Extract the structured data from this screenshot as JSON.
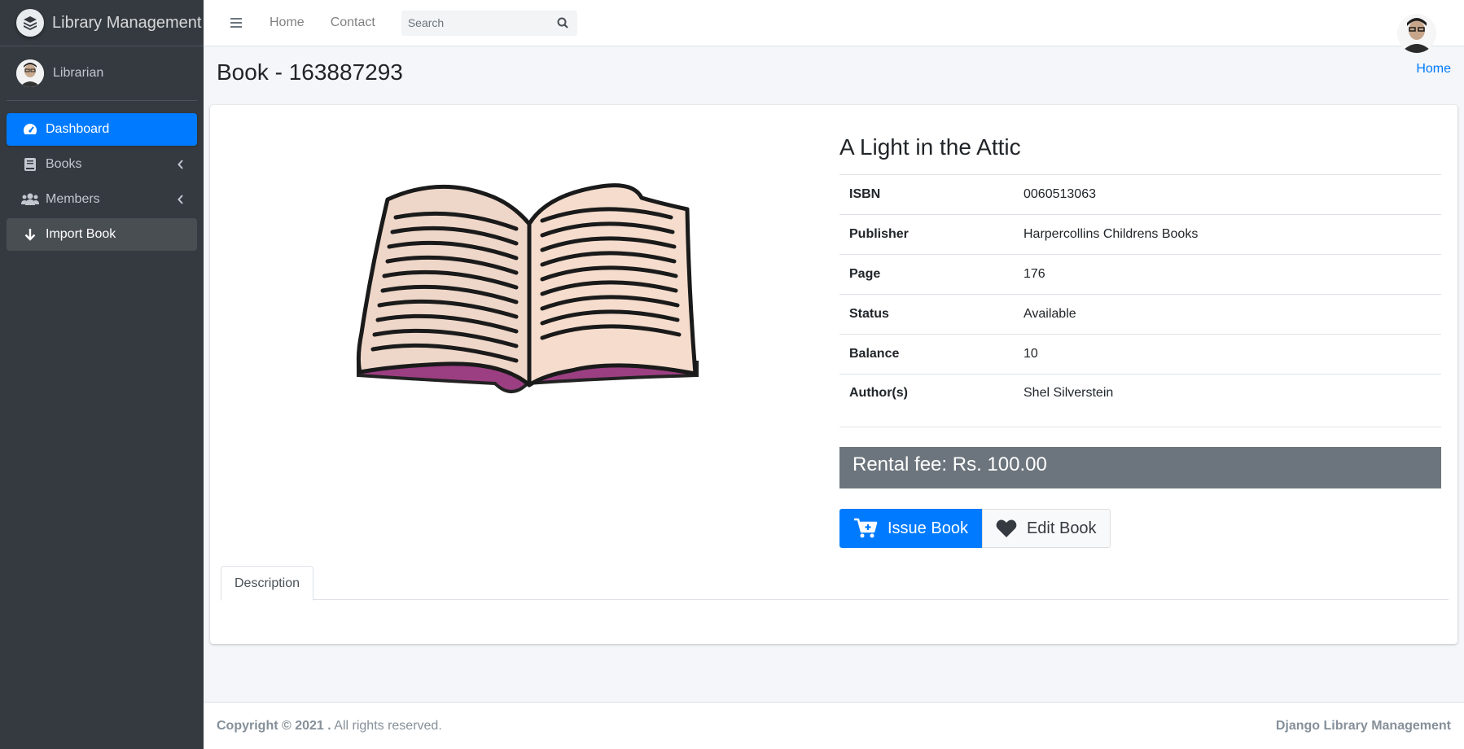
{
  "brand": {
    "name": "Library Management",
    "icon": "layers-logo-icon"
  },
  "user": {
    "name": "Librarian"
  },
  "sidebar": {
    "items": [
      {
        "label": "Dashboard",
        "icon": "tachometer-icon",
        "active": true
      },
      {
        "label": "Books",
        "icon": "book-icon",
        "has_children": true
      },
      {
        "label": "Members",
        "icon": "users-icon",
        "has_children": true
      },
      {
        "label": "Import Book",
        "icon": "arrow-down-icon"
      }
    ]
  },
  "topbar": {
    "links": [
      "Home",
      "Contact"
    ],
    "search_placeholder": "Search"
  },
  "page": {
    "title": "Book - 163887293",
    "breadcrumb": "Home"
  },
  "book": {
    "title": "A Light in the Attic",
    "details": [
      {
        "key": "ISBN",
        "value": "0060513063"
      },
      {
        "key": "Publisher",
        "value": "Harpercollins Childrens Books"
      },
      {
        "key": "Page",
        "value": "176"
      },
      {
        "key": "Status",
        "value": "Available"
      },
      {
        "key": "Balance",
        "value": "10"
      },
      {
        "key": "Author(s)",
        "value": "Shel Silverstein"
      }
    ],
    "rental_fee": "Rental fee: Rs. 100.00"
  },
  "actions": {
    "issue": "Issue Book",
    "edit": "Edit Book"
  },
  "tabs": [
    "Description"
  ],
  "footer": {
    "copyright_bold": "Copyright © 2021 .",
    "copyright_rest": " All rights reserved.",
    "right": "Django Library Management"
  },
  "colors": {
    "primary": "#007bff",
    "sidebar": "#343a40",
    "fee_bg": "#6c757d"
  }
}
